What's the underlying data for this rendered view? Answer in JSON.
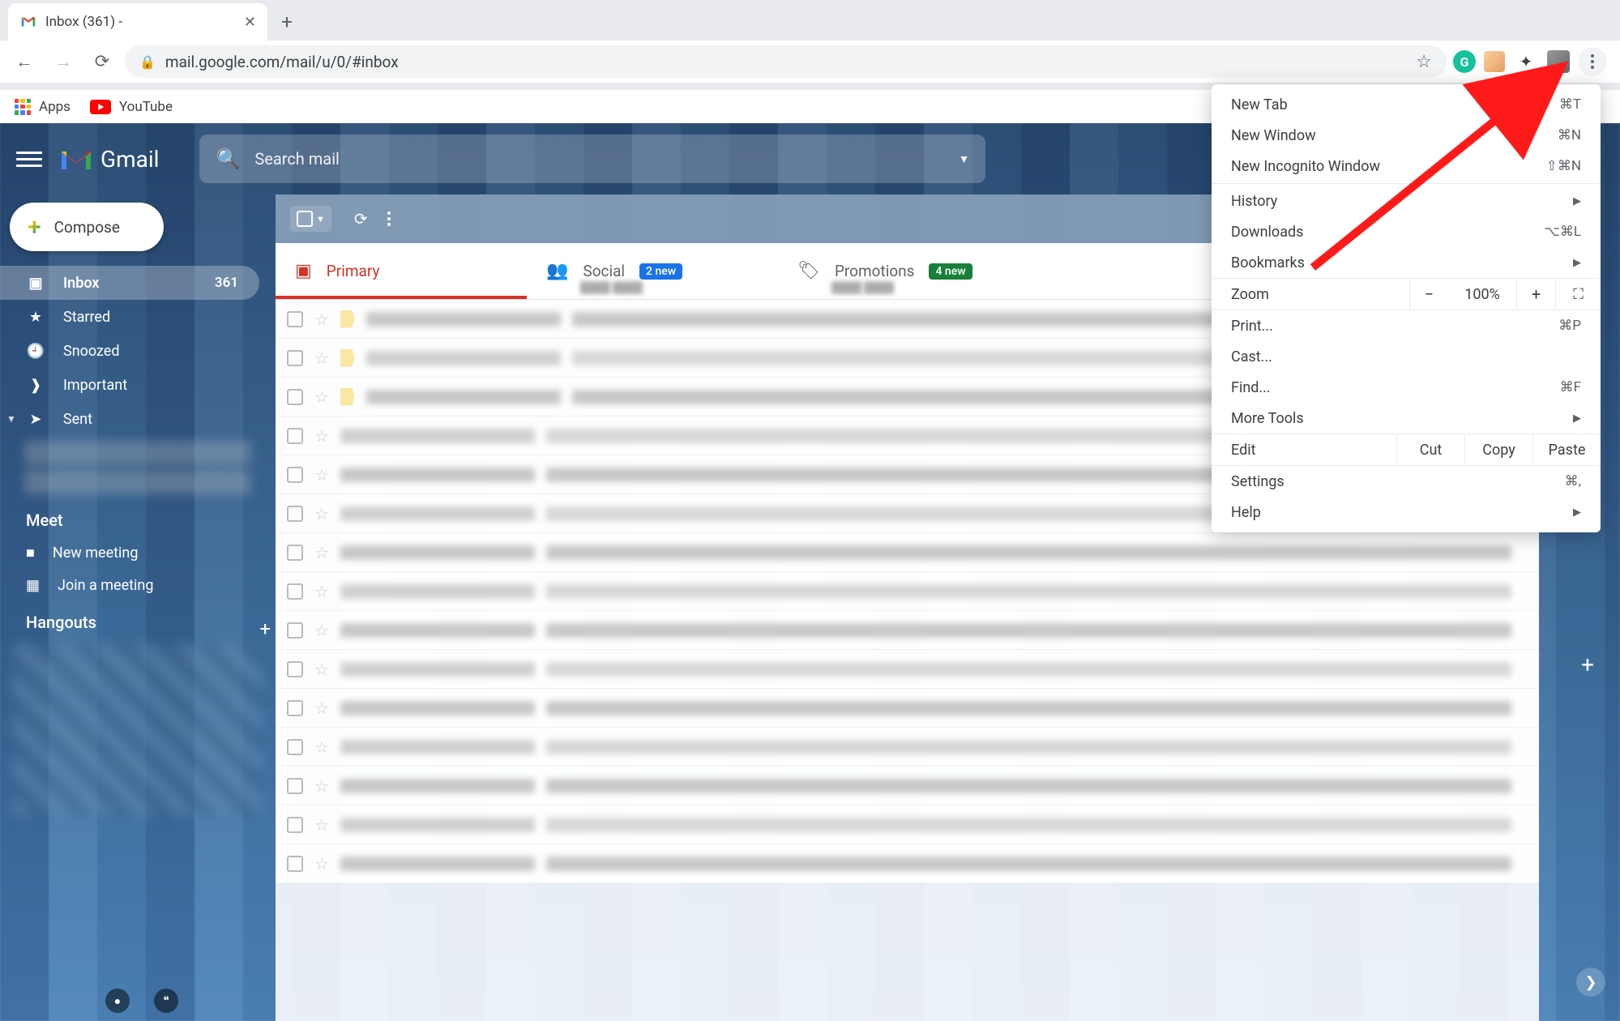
{
  "browser": {
    "tab_title": "Inbox (361) -",
    "url": "mail.google.com/mail/u/0/#inbox",
    "bookmarks": {
      "apps": "Apps",
      "youtube": "YouTube"
    }
  },
  "gmail": {
    "brand": "Gmail",
    "search_placeholder": "Search mail",
    "compose": "Compose",
    "sidebar": [
      {
        "icon": "inbox-icon",
        "label": "Inbox",
        "count": "361",
        "active": true
      },
      {
        "icon": "star-icon",
        "label": "Starred"
      },
      {
        "icon": "clock-icon",
        "label": "Snoozed"
      },
      {
        "icon": "important-icon",
        "label": "Important"
      },
      {
        "icon": "sent-icon",
        "label": "Sent"
      }
    ],
    "meet": {
      "title": "Meet",
      "new_meeting": "New meeting",
      "join_meeting": "Join a meeting"
    },
    "hangouts": {
      "title": "Hangouts"
    },
    "tabs": {
      "primary": "Primary",
      "social": "Social",
      "social_badge": "2 new",
      "promotions": "Promotions",
      "promotions_badge": "4 new"
    }
  },
  "chrome_menu": {
    "new_tab": "New Tab",
    "new_tab_k": "⌘T",
    "new_window": "New Window",
    "new_window_k": "⌘N",
    "new_incognito": "New Incognito Window",
    "new_incognito_k": "⇧⌘N",
    "history": "History",
    "downloads": "Downloads",
    "downloads_k": "⌥⌘L",
    "bookmarks": "Bookmarks",
    "zoom": "Zoom",
    "zoom_minus": "−",
    "zoom_val": "100%",
    "zoom_plus": "+",
    "print": "Print...",
    "print_k": "⌘P",
    "cast": "Cast...",
    "find": "Find...",
    "find_k": "⌘F",
    "more_tools": "More Tools",
    "edit": "Edit",
    "cut": "Cut",
    "copy": "Copy",
    "paste": "Paste",
    "settings": "Settings",
    "settings_k": "⌘,",
    "help": "Help"
  }
}
